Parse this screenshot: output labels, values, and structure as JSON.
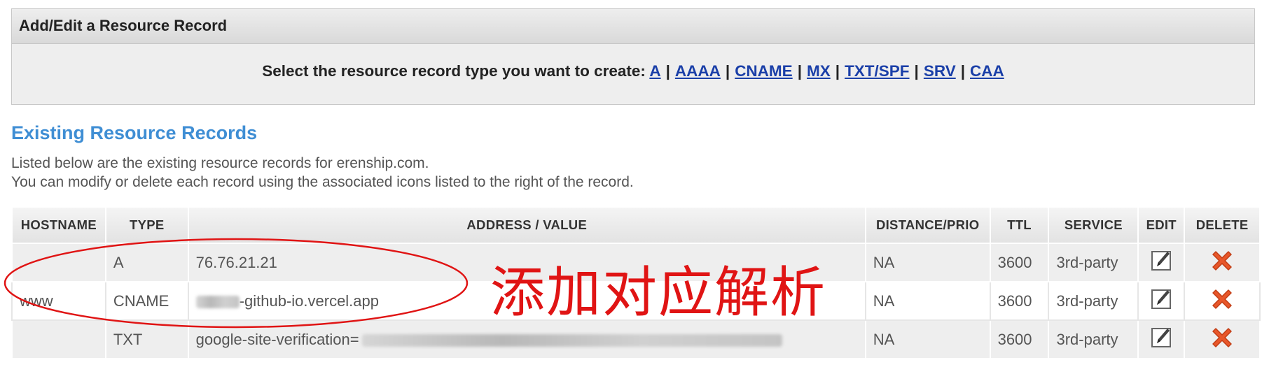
{
  "panel": {
    "title": "Add/Edit a Resource Record",
    "prompt": "Select the resource record type you want to create:",
    "types": [
      "A",
      "AAAA",
      "CNAME",
      "MX",
      "TXT/SPF",
      "SRV",
      "CAA"
    ],
    "separator": "|"
  },
  "existing": {
    "title": "Existing Resource Records",
    "line1": "Listed below are the existing resource records for erenship.com.",
    "line2": "You can modify or delete each record using the associated icons listed to the right of the record."
  },
  "table": {
    "headers": {
      "hostname": "HOSTNAME",
      "type": "TYPE",
      "address": "ADDRESS / VALUE",
      "distance": "DISTANCE/PRIO",
      "ttl": "TTL",
      "service": "SERVICE",
      "edit": "EDIT",
      "delete": "DELETE"
    },
    "rows": [
      {
        "hostname": "",
        "type": "A",
        "address": "76.76.21.21",
        "distance": "NA",
        "ttl": "3600",
        "service": "3rd-party"
      },
      {
        "hostname": "www",
        "type": "CNAME",
        "address": "-github-io.vercel.app",
        "distance": "NA",
        "ttl": "3600",
        "service": "3rd-party"
      },
      {
        "hostname": "",
        "type": "TXT",
        "address": "google-site-verification=",
        "distance": "NA",
        "ttl": "3600",
        "service": "3rd-party"
      }
    ]
  },
  "annotation": "添加对应解析",
  "colors": {
    "link": "#1a3fa8",
    "section_title": "#3f8ed4",
    "annotation": "#e01414",
    "delete_icon": "#e8572a"
  }
}
